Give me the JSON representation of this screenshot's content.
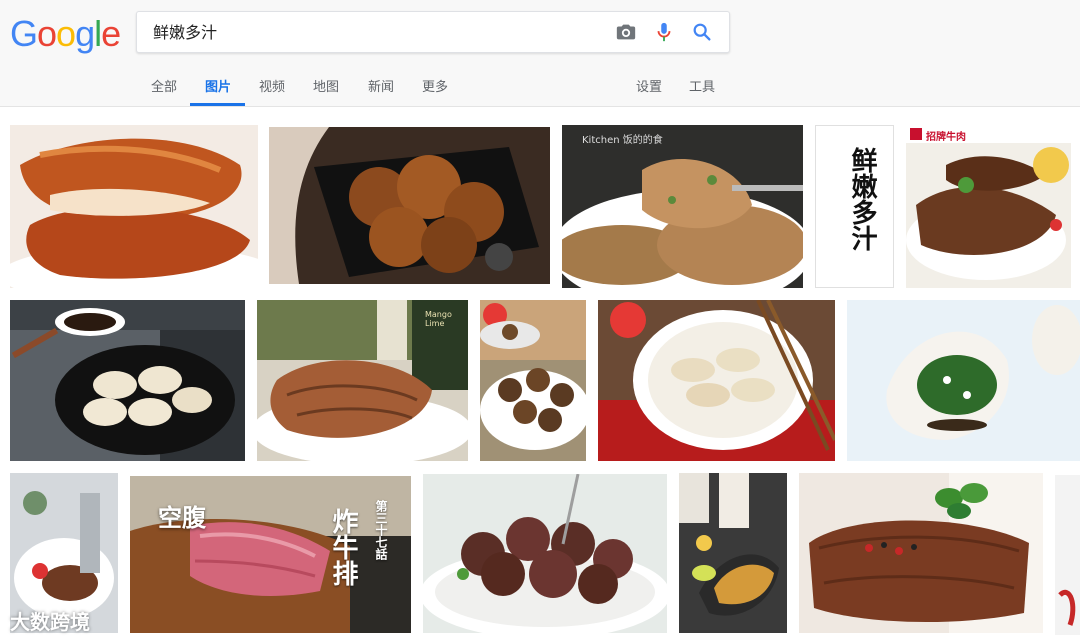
{
  "header": {
    "logo": [
      "G",
      "o",
      "o",
      "g",
      "l",
      "e"
    ],
    "logo_colors": [
      "#4285F4",
      "#EA4335",
      "#FBBC05",
      "#4285F4",
      "#34A853",
      "#EA4335"
    ],
    "search": {
      "value": "鲜嫩多汁"
    },
    "icons": {
      "camera": "camera-icon",
      "mic": "mic-icon",
      "search": "search-icon"
    }
  },
  "tabs": {
    "all": "全部",
    "images": "图片",
    "videos": "视频",
    "maps": "地图",
    "news": "新闻",
    "more": "更多",
    "settings": "设置",
    "tools": "工具"
  },
  "accent_color": "#1a73e8",
  "thumbnails": {
    "t1": {
      "alt": "roast chicken wings"
    },
    "t2": {
      "alt": "fried chicken"
    },
    "t3": {
      "alt": "coated potato bites",
      "caption": "Kitchen 饭的的食"
    },
    "t4": {
      "alt": "calligraphy",
      "text": "鲜嫩多汁"
    },
    "t5": {
      "alt": "steak with vegetables",
      "brand": "招牌牛肉"
    },
    "t6": {
      "alt": "dumplings in pan"
    },
    "t7": {
      "alt": "grilled pork chop",
      "label": "Mango Lime"
    },
    "t8": {
      "alt": "stuffed mushrooms"
    },
    "t9": {
      "alt": "plate of dumplings"
    },
    "t10": {
      "alt": "spinach dumpling"
    },
    "t11": {
      "alt": "steak plate"
    },
    "t12": {
      "alt": "fried beef cutlet",
      "title": "炸牛排",
      "brand": "空腹",
      "side": "第三十七話"
    },
    "t13": {
      "alt": "meat stuffed mushrooms"
    },
    "t14": {
      "alt": "grilled fish"
    },
    "t15": {
      "alt": "steak with basil"
    }
  },
  "watermark": "大数跨境"
}
